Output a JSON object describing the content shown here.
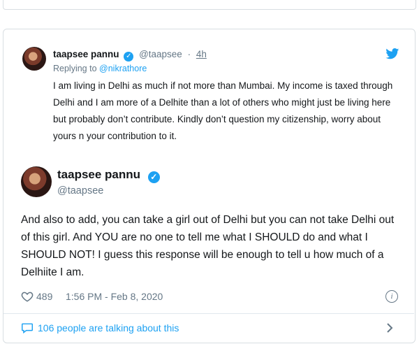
{
  "quoted_tweet": {
    "name": "taapsee pannu",
    "handle": "@taapsee",
    "separator": "·",
    "time": "4h",
    "replying_prefix": "Replying to",
    "replying_to": "@nikrathore",
    "text": "I am living in Delhi as much if not more than Mumbai. My income is taxed through Delhi and I am more of a Delhite than a lot of others who might just be living here but probably don’t contribute. Kindly don’t question my citizenship, worry about yours n your contribution to it."
  },
  "main_tweet": {
    "name": "taapsee pannu",
    "handle": "@taapsee",
    "text": "And also to add, you can take a girl out of Delhi but you can not take Delhi out of this girl. And YOU are no one to tell me what I SHOULD do and what I SHOULD NOT! I guess this response will be enough to tell u how much of a Delhiite I am.",
    "likes": "489",
    "timestamp": "1:56 PM - Feb 8, 2020",
    "talking": "106 people are talking about this"
  },
  "icons": {
    "verified": "verified-badge-icon",
    "bird": "twitter-bird-icon",
    "heart": "heart-icon",
    "info": "info-icon",
    "bubble": "speech-bubble-icon",
    "chevron": "chevron-right-icon"
  },
  "colors": {
    "accent": "#1da1f2",
    "muted": "#657786",
    "text": "#14171a",
    "border": "#d8dee2"
  }
}
